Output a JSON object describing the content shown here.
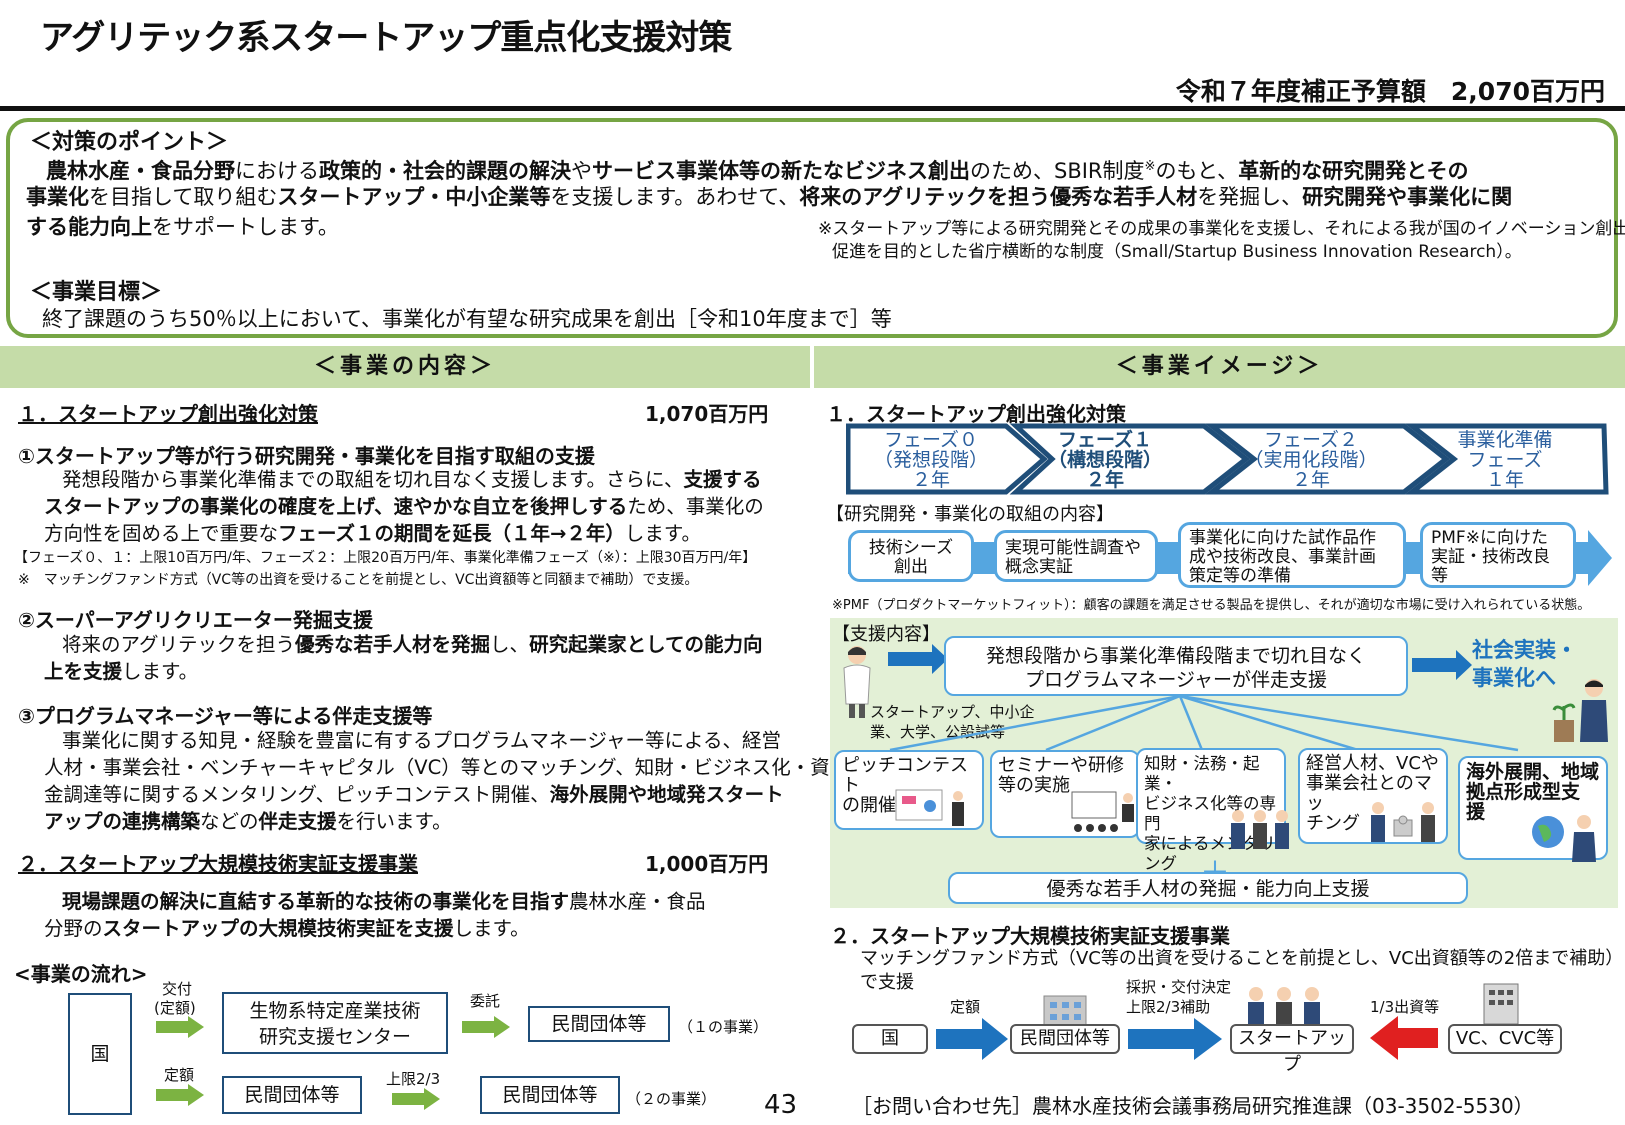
{
  "title": "アグリテック系スタートアップ重点化支援対策",
  "budget": "令和７年度補正予算額　2,070百万円",
  "points": {
    "heading": "＜対策のポイント＞",
    "line1": [
      "農林水産・食品分野",
      "における",
      "政策的・社会的課題の解決",
      "や",
      "サービス事業体等の新たなビジネス創出",
      "のため、SBIR制度",
      "※",
      "のもと、",
      "革新的な研究開発とその"
    ],
    "line2": [
      "事業化",
      "を目指して取り組む",
      "スタートアップ・中小企業等",
      "を支援します。あわせて、",
      "将来のアグリテックを担う優秀な若手人材",
      "を発掘し、",
      "研究開発や事業化に関"
    ],
    "line3": [
      "する能力向上",
      "をサポートします。"
    ],
    "note1": "※スタートアップ等による研究開発とその成果の事業化を支援し、それによる我が国のイノベーション創出の",
    "note2": "促進を目的とした省庁横断的な制度（Small/Startup Business Innovation Research）。",
    "goal_heading": "＜事業目標＞",
    "goal": "終了課題のうち50％以上において、事業化が有望な研究成果を創出［令和10年度まで］等"
  },
  "left_bar": "＜事業の内容＞",
  "right_bar": "＜事業イメージ＞",
  "left": {
    "s1_title": "１．スタートアップ創出強化対策",
    "s1_amount": "1,070百万円",
    "i1_title": "①スタートアップ等が行う研究開発・事業化を目指す取組の支援",
    "i1_l1a": "発想段階から事業化準備までの取組を切れ目なく支援します。さらに、",
    "i1_l1b": "支援する",
    "i1_l2a": "スタートアップの事業化の確度を上げ、速やかな自立を後押しする",
    "i1_l2b": "ため、事業化の",
    "i1_l3a": "方向性を固める上で重要な",
    "i1_l3b": "フェーズ１の期間を延長（１年→２年）",
    "i1_l3c": "します。",
    "i1_note1": "【フェーズ０、１：上限10百万円/年、フェーズ２：上限20百万円/年、事業化準備フェーズ（※）：上限30百万円/年】",
    "i1_note2": "※　マッチングファンド方式（VC等の出資を受けることを前提とし、VC出資額等と同額まで補助）で支援。",
    "i2_title": "②スーパーアグリクリエーター発掘支援",
    "i2_l1a": "将来のアグリテックを担う",
    "i2_l1b": "優秀な若手人材を発掘",
    "i2_l1c": "し、",
    "i2_l1d": "研究起業家としての能力向",
    "i2_l2a": "上を支援",
    "i2_l2b": "します。",
    "i3_title": "③プログラムマネージャー等による伴走支援等",
    "i3_l1": "事業化に関する知見・経験を豊富に有するプログラムマネージャー等による、経営",
    "i3_l2": "人材・事業会社・ベンチャーキャピタル（VC）等とのマッチング、知財・ビジネス化・資",
    "i3_l3a": "金調達等に関するメンタリング、ピッチコンテスト開催、",
    "i3_l3b": "海外展開や地域発スタート",
    "i3_l4a": "アップの連携構築",
    "i3_l4b": "などの",
    "i3_l4c": "伴走支援",
    "i3_l4d": "を行います。",
    "s2_title": "２．スタートアップ大規模技術実証支援事業",
    "s2_amount": "1,000百万円",
    "s2_l1a": "現場課題の解決に直結する革新的な技術の事業化を目指す",
    "s2_l1b": "農林水産・食品",
    "s2_l2a": "分野の",
    "s2_l2b": "スタートアップの大規模技術実証を支援",
    "s2_l2c": "します。",
    "flow_title": "<事業の流れ>",
    "flow": {
      "country": "国",
      "grant_label1": "交付",
      "grant_label2": "(定額)",
      "center": [
        "生物系特定産業技術",
        "研究支援センター"
      ],
      "entrust": "委託",
      "org1": "民間団体等",
      "note1": "（１の事業）",
      "fixed": "定額",
      "org2": "民間団体等",
      "limit": "上限2/3",
      "org3": "民間団体等",
      "note2": "（２の事業）"
    }
  },
  "page_number": "43",
  "right": {
    "s1_title": "１．スタートアップ創出強化対策",
    "phases": [
      {
        "l1": "フェーズ０",
        "l2": "（発想段階）",
        "l3": "２年"
      },
      {
        "l1": "フェーズ１",
        "l2": "（構想段階）",
        "l3": "２年"
      },
      {
        "l1": "フェーズ２",
        "l2": "（実用化段階）",
        "l3": "２年"
      },
      {
        "l1": "事業化準備",
        "l2": "フェーズ",
        "l3": "１年"
      }
    ],
    "rd_label": "【研究開発・事業化の取組の内容】",
    "rd_boxes": [
      {
        "l1": "技術シーズ",
        "l2": "創出",
        "l3": ""
      },
      {
        "l1": "実現可能性調査や",
        "l2": "概念実証",
        "l3": ""
      },
      {
        "l1": "事業化に向けた試作品作",
        "l2": "成や技術改良、事業計画",
        "l3": "策定等の準備"
      },
      {
        "l1": "PMF※に向けた",
        "l2": "実証・技術改良",
        "l3": "等"
      }
    ],
    "pmf_note": "※PMF（プロダクトマーケットフィット）：顧客の課題を満足させる製品を提供し、それが適切な市場に受け入れられている状態。",
    "support_label": "【支援内容】",
    "support_main1": "発想段階から事業化準備段階まで切れ目なく",
    "support_main2": "プログラムマネージャーが伴走支援",
    "social1": "社会実装・",
    "social2": "事業化へ",
    "targets1": "スタートアップ、中小企",
    "targets2": "業、大学、公設試等",
    "support_items": [
      {
        "l1": "ピッチコンテスト",
        "l2": "の開催",
        "l3": ""
      },
      {
        "l1": "セミナーや研修",
        "l2": "等の実施",
        "l3": ""
      },
      {
        "l1": "知財・法務・起業・",
        "l2": "ビジネス化等の専門",
        "l3": "家によるメンタリング"
      },
      {
        "l1": "経営人材、VCや",
        "l2": "事業会社とのマッ",
        "l3": "チング"
      },
      {
        "l1": "海外展開、地域",
        "l2": "拠点形成型支",
        "l3": "援"
      }
    ],
    "talent": "優秀な若手人材の発掘・能力向上支援",
    "s2_title": "２．スタートアップ大規模技術実証支援事業",
    "s2_l1": "マッチングファンド方式（VC等の出資を受けることを前提とし、VC出資額等の2倍まで補助）",
    "s2_l2": "で支援",
    "flow": {
      "country": "国",
      "fixed": "定額",
      "org": "民間団体等",
      "adopt1": "採択・交付決定",
      "adopt2": "上限2/3補助",
      "startup": "スタートアップ",
      "invest": "1/3出資等",
      "vc": "VC、CVC等"
    },
    "contact": "［お問い合わせ先］農林水産技術会議事務局研究推進課（03-3502-5530）"
  },
  "colors": {
    "green_border": "#76a544",
    "bar": "#c5dca8",
    "navy": "#1f4e79",
    "light_blue": "#55a6e0",
    "blue_arrow": "#1e73be",
    "red_arrow": "#e02020",
    "support_bg": "#e3f0d6"
  }
}
